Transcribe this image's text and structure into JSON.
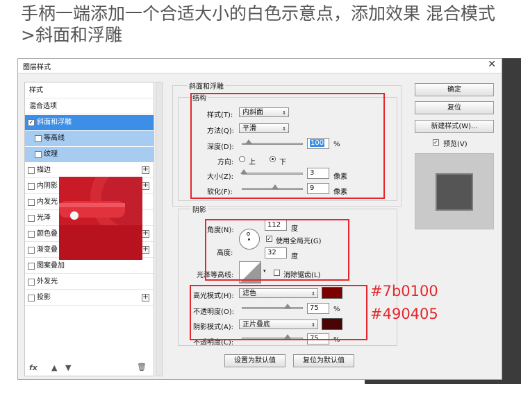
{
  "heading": "手柄一端添加一个合适大小的白色示意点，添加效果 混合模式>斜面和浮雕",
  "dialog": {
    "title": "图层样式",
    "close_icon": "close-icon"
  },
  "styles_list": [
    {
      "label": "样式",
      "checkbox": false,
      "checked": false,
      "plus": false,
      "state": "normal"
    },
    {
      "label": "混合选项",
      "checkbox": false,
      "checked": false,
      "plus": false,
      "state": "normal"
    },
    {
      "label": "斜面和浮雕",
      "checkbox": true,
      "checked": true,
      "plus": false,
      "state": "selected"
    },
    {
      "label": "等高线",
      "checkbox": true,
      "checked": false,
      "plus": false,
      "state": "sub"
    },
    {
      "label": "纹理",
      "checkbox": true,
      "checked": false,
      "plus": false,
      "state": "sub"
    },
    {
      "label": "描边",
      "checkbox": true,
      "checked": false,
      "plus": true,
      "state": "normal"
    },
    {
      "label": "内阴影",
      "checkbox": true,
      "checked": false,
      "plus": true,
      "state": "normal"
    },
    {
      "label": "内发光",
      "checkbox": true,
      "checked": false,
      "plus": false,
      "state": "normal"
    },
    {
      "label": "光泽",
      "checkbox": true,
      "checked": false,
      "plus": false,
      "state": "normal"
    },
    {
      "label": "颜色叠",
      "checkbox": true,
      "checked": false,
      "plus": true,
      "state": "normal"
    },
    {
      "label": "渐变叠",
      "checkbox": true,
      "checked": false,
      "plus": true,
      "state": "normal"
    },
    {
      "label": "图案叠加",
      "checkbox": true,
      "checked": false,
      "plus": false,
      "state": "normal"
    },
    {
      "label": "外发光",
      "checkbox": true,
      "checked": false,
      "plus": false,
      "state": "normal"
    },
    {
      "label": "投影",
      "checkbox": true,
      "checked": false,
      "plus": true,
      "state": "normal"
    }
  ],
  "bottom_bar": {
    "fx_label": "fx"
  },
  "bevel": {
    "section_title": "斜面和浮雕",
    "structure_title": "结构",
    "style_label": "样式(T):",
    "style_value": "内斜面",
    "technique_label": "方法(Q):",
    "technique_value": "平滑",
    "depth_label": "深度(D):",
    "depth_value": "100",
    "depth_unit": "%",
    "depth_slider": 0.1,
    "direction_label": "方向:",
    "direction_up": "上",
    "direction_down": "下",
    "size_label": "大小(Z):",
    "size_value": "3",
    "size_unit": "像素",
    "size_slider": 0.02,
    "soften_label": "软化(F):",
    "soften_value": "9",
    "soften_unit": "像素",
    "soften_slider": 0.55
  },
  "shading": {
    "title": "阴影",
    "angle_label": "角度(N):",
    "angle_value": "112",
    "angle_unit": "度",
    "global_light_label": "使用全局光(G)",
    "altitude_label": "高度:",
    "altitude_value": "32",
    "altitude_unit": "度",
    "gloss_label": "光泽等高线:",
    "anti_alias_label": "消除锯齿(L)",
    "highlight_mode_label": "高光模式(H):",
    "highlight_mode_value": "滤色",
    "highlight_color": "#7b0100",
    "highlight_opacity_label": "不透明度(O):",
    "highlight_opacity_value": "75",
    "highlight_opacity_unit": "%",
    "highlight_opacity_slider": 0.75,
    "shadow_mode_label": "阴影模式(A):",
    "shadow_mode_value": "正片叠底",
    "shadow_color": "#490405",
    "shadow_opacity_label": "不透明度(C):",
    "shadow_opacity_value": "75",
    "shadow_opacity_unit": "%",
    "shadow_opacity_slider": 0.75
  },
  "footer_buttons": {
    "set_default": "设置为默认值",
    "reset_default": "复位为默认值"
  },
  "right_buttons": {
    "ok": "确定",
    "reset": "复位",
    "new_style": "新建样式(W)...",
    "preview_label": "预览(V)"
  },
  "annotations": {
    "color1": "#7b0100",
    "color2": "#490405"
  }
}
